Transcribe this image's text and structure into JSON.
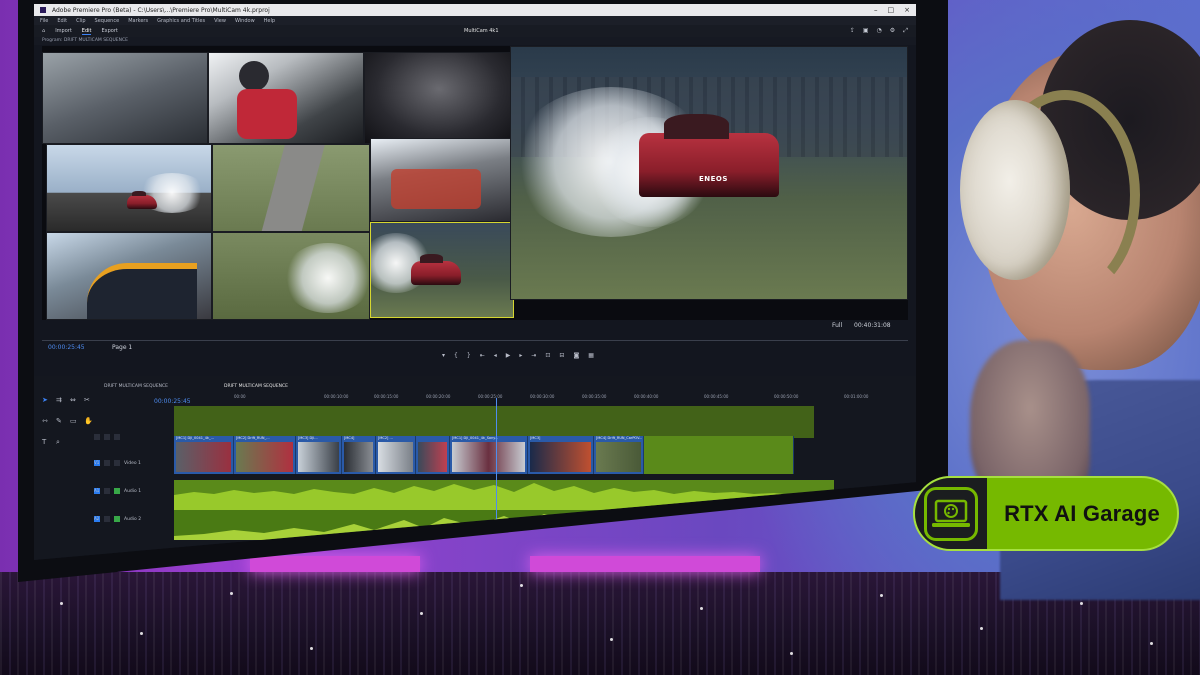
{
  "window": {
    "title": "Adobe Premiere Pro (Beta) - C:\\Users\\...\\Premiere Pro\\MultiCam 4k.prproj",
    "menu": [
      "File",
      "Edit",
      "Clip",
      "Sequence",
      "Markers",
      "Graphics and Titles",
      "View",
      "Window",
      "Help"
    ],
    "tabs": [
      "Import",
      "Edit",
      "Export"
    ],
    "active_tab": "Edit",
    "center_title": "MultiCam 4k1",
    "panel_label": "Program: DRIFT MULTICAM SEQUENCE"
  },
  "program_monitor": {
    "timecode_left": "00:00:25:45",
    "fit_label": "Page 1",
    "zoom_label": "Full",
    "timecode_right": "00:40:31:08",
    "big_cam_text": "ENEOS"
  },
  "timeline": {
    "sequence_name": "DRIFT MULTICAM SEQUENCE",
    "tab_name": "DRIFT MULTICAM SEQUENCE",
    "timecode": "00:00:25:45",
    "ruler_ticks": [
      "00:00",
      "00:00:10:00",
      "00:00:15:00",
      "00:00:20:00",
      "00:00:25:00",
      "00:00:30:00",
      "00:00:35:00",
      "00:00:40:00",
      "00:00:45:00",
      "00:00:50:00",
      "00:01:00:00"
    ],
    "tracks": {
      "video": [
        "V1",
        "Video 1"
      ],
      "audio1": [
        "A1",
        "Audio 1"
      ],
      "audio2": [
        "A2",
        "Audio 2"
      ]
    },
    "clips": [
      "[MC1] DJI_0041_4k_...",
      "[MC2] Drift_RUN_...",
      "[MC3] DJI...",
      "[MC4]",
      "[MC2] ...",
      "[MC1] DJI_0041_4k_Sony...",
      "[MC3]",
      "[MC4] Drift_RUN_CarPOV..."
    ]
  },
  "badge": {
    "text": "RTX AI Garage"
  },
  "colors": {
    "nvidia_green": "#76b900",
    "premiere_blue": "#3b82f6",
    "audio_green": "#5a8a1a",
    "clip_blue": "#2a5aa8"
  }
}
